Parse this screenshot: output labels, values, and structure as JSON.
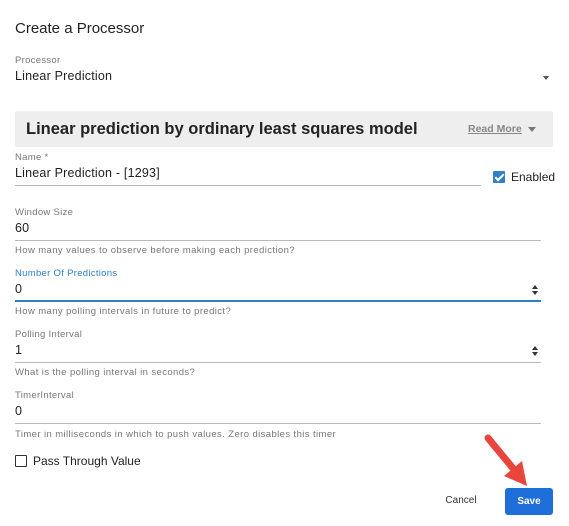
{
  "dialog": {
    "title": "Create a Processor"
  },
  "processor": {
    "label": "Processor",
    "value": "Linear Prediction"
  },
  "banner": {
    "title": "Linear prediction by ordinary least squares model",
    "read_more": "Read More"
  },
  "name_field": {
    "label": "Name *",
    "value": "Linear Prediction  - [1293]"
  },
  "enabled": {
    "label": "Enabled",
    "checked": true
  },
  "window_size": {
    "label": "Window Size",
    "value": "60",
    "hint": "How many values to observe before making each prediction?"
  },
  "number_of_predictions": {
    "label": "Number Of Predictions",
    "value": "0",
    "hint": "How many polling intervals in future to predict?"
  },
  "polling_interval": {
    "label": "Polling Interval",
    "value": "1",
    "hint": "What is the polling interval in seconds?"
  },
  "timer_interval": {
    "label": "TimerInterval",
    "value": "0",
    "hint": "Timer in milliseconds in which to push values. Zero disables this timer"
  },
  "pass_through": {
    "label": "Pass Through Value",
    "checked": false
  },
  "actions": {
    "cancel_label": "Cancel",
    "save_label": "Save"
  },
  "colors": {
    "accent": "#2f80c9",
    "save_button": "#1e6fd9",
    "annotation_arrow": "#e8453c"
  },
  "icons": [
    "dropdown-caret-icon",
    "chevron-down-icon",
    "checkbox-checked-icon",
    "spinner-icon",
    "checkbox-unchecked-icon",
    "annotation-arrow-icon"
  ]
}
